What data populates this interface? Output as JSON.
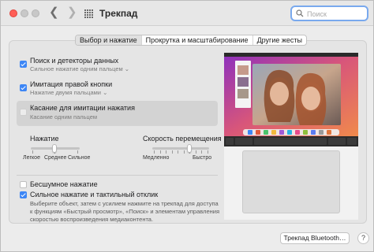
{
  "window": {
    "title": "Трекпад"
  },
  "search": {
    "placeholder": "Поиск"
  },
  "tabs": [
    {
      "label": "Выбор и нажатие"
    },
    {
      "label": "Прокрутка и масштабирование"
    },
    {
      "label": "Другие жесты"
    }
  ],
  "options": [
    {
      "title": "Поиск и детекторы данных",
      "subtitle": "Сильное нажатие одним пальцем",
      "checked": true
    },
    {
      "title": "Имитация правой кнопки",
      "subtitle": "Нажатие двумя пальцами",
      "checked": true
    },
    {
      "title": "Касание для имитации нажатия",
      "subtitle": "Касание одним пальцем",
      "checked": false
    }
  ],
  "click_slider": {
    "title": "Нажатие",
    "labels": [
      "Легкое",
      "Среднее",
      "Сильное"
    ],
    "value_index": 1
  },
  "speed_slider": {
    "title": "Скорость перемещения",
    "labels": [
      "Медленно",
      "Быстро"
    ],
    "value_fraction": 0.65
  },
  "silent_click": {
    "label": "Бесшумное нажатие",
    "checked": false
  },
  "force_click": {
    "label": "Сильное нажатие и тактильный отклик",
    "checked": true,
    "description": "Выберите объект, затем с усилием нажмите на трекпад для доступа к функциям «Быстрый просмотр», «Поиск» и элементам управления скоростью воспроизведения медиаконтента."
  },
  "bluetooth_button": {
    "label": "Трекпад Bluetooth…"
  },
  "help_button": {
    "label": "?"
  },
  "colors": {
    "accent": "#3d86f5",
    "close": "#ff5f57",
    "search_ring": "#79a9ee"
  },
  "icons": {
    "back": "chevron-left-icon",
    "forward": "chevron-right-icon",
    "grid": "grid-icon",
    "search": "search-icon"
  }
}
